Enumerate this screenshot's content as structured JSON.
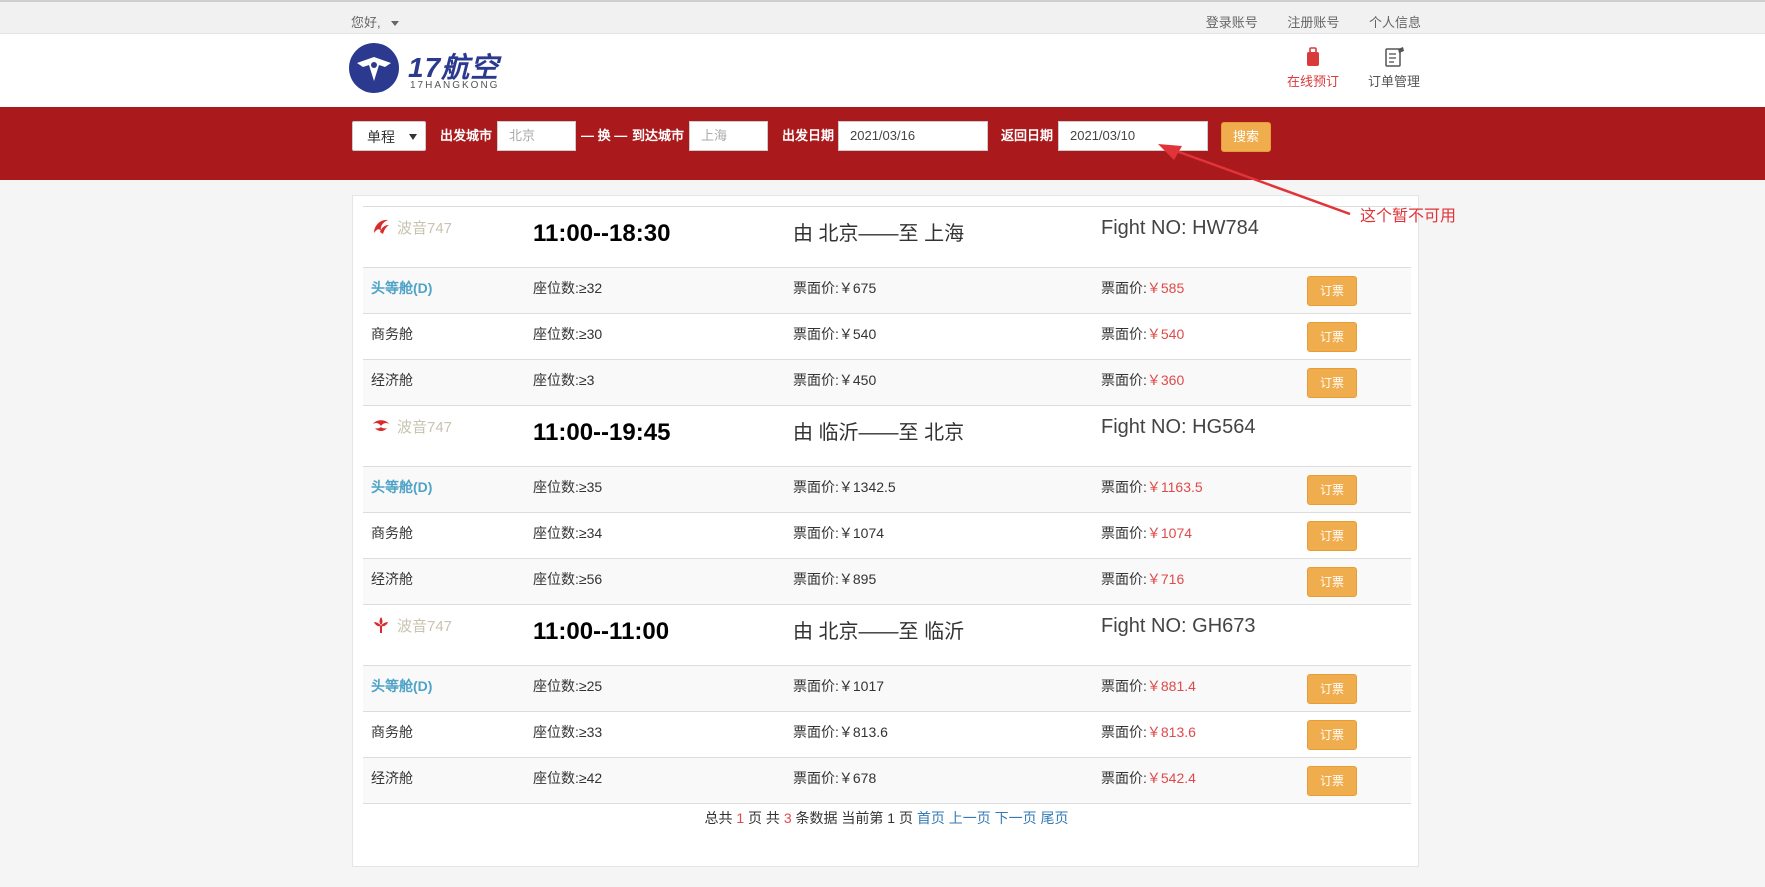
{
  "topbar": {
    "greeting": "您好,",
    "links": [
      "登录账号",
      "注册账号",
      "个人信息"
    ]
  },
  "header": {
    "logo_title": "17航空",
    "logo_sub": "17HANGKONG",
    "book_label": "在线预订",
    "order_label": "订单管理"
  },
  "search": {
    "trip_type": "单程",
    "depart_city_label": "出发城市",
    "depart_city_placeholder": "北京",
    "swap_label": "— 换 —",
    "arrive_city_label": "到达城市",
    "arrive_city_placeholder": "上海",
    "depart_date_label": "出发日期",
    "depart_date": "2021/03/16",
    "return_date_label": "返回日期",
    "return_date": "2021/03/10",
    "search_button": "搜索"
  },
  "annotation": {
    "text": "这个暂不可用",
    "color": "#e0343a"
  },
  "flights": [
    {
      "airline_icon": "air-china-icon",
      "plane": "波音747",
      "time": "11:00--18:30",
      "route": "由 北京——至 上海",
      "flight_no": "Fight NO: HW784",
      "cabins": [
        {
          "name": "头等舱(D)",
          "seats": "座位数:≥32",
          "price": "票面价:￥675",
          "disc_label": "票面价:",
          "disc_value": "￥585",
          "book": "订票"
        },
        {
          "name": "商务舱",
          "seats": "座位数:≥30",
          "price": "票面价:￥540",
          "disc_label": "票面价:",
          "disc_value": "￥540",
          "book": "订票"
        },
        {
          "name": "经济舱",
          "seats": "座位数:≥3",
          "price": "票面价:￥450",
          "disc_label": "票面价:",
          "disc_value": "￥360",
          "book": "订票"
        }
      ]
    },
    {
      "airline_icon": "hainan-airlines-icon",
      "plane": "波音747",
      "time": "11:00--19:45",
      "route": "由 临沂——至 北京",
      "flight_no": "Fight NO: HG564",
      "cabins": [
        {
          "name": "头等舱(D)",
          "seats": "座位数:≥35",
          "price": "票面价:￥1342.5",
          "disc_label": "票面价:",
          "disc_value": "￥1163.5",
          "book": "订票"
        },
        {
          "name": "商务舱",
          "seats": "座位数:≥34",
          "price": "票面价:￥1074",
          "disc_label": "票面价:",
          "disc_value": "￥1074",
          "book": "订票"
        },
        {
          "name": "经济舱",
          "seats": "座位数:≥56",
          "price": "票面价:￥895",
          "disc_label": "票面价:",
          "disc_value": "￥716",
          "book": "订票"
        }
      ]
    },
    {
      "airline_icon": "china-southern-icon",
      "plane": "波音747",
      "time": "11:00--11:00",
      "route": "由 北京——至 临沂",
      "flight_no": "Fight NO: GH673",
      "cabins": [
        {
          "name": "头等舱(D)",
          "seats": "座位数:≥25",
          "price": "票面价:￥1017",
          "disc_label": "票面价:",
          "disc_value": "￥881.4",
          "book": "订票"
        },
        {
          "name": "商务舱",
          "seats": "座位数:≥33",
          "price": "票面价:￥813.6",
          "disc_label": "票面价:",
          "disc_value": "￥813.6",
          "book": "订票"
        },
        {
          "name": "经济舱",
          "seats": "座位数:≥42",
          "price": "票面价:￥678",
          "disc_label": "票面价:",
          "disc_value": "￥542.4",
          "book": "订票"
        }
      ]
    }
  ],
  "pager": {
    "t1": "总共",
    "pages": "1",
    "t2": "页 共",
    "records": "3",
    "t3": "条数据 当前第",
    "current": "1",
    "t4": "页",
    "first": "首页",
    "prev": "上一页",
    "next": "下一页",
    "last": "尾页"
  }
}
